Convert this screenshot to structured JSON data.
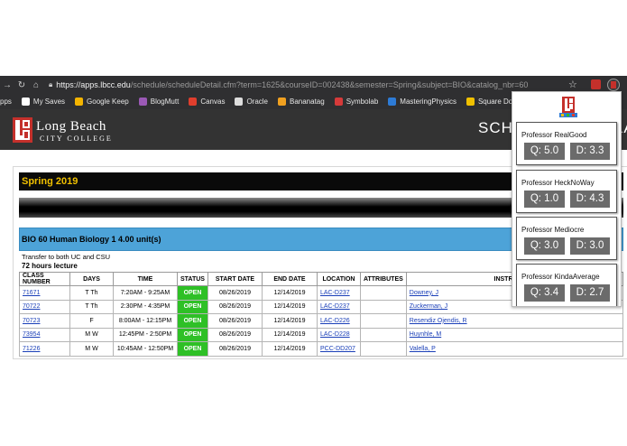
{
  "browser": {
    "url_host": "https://apps.lbcc.edu",
    "url_path": "/schedule/scheduleDetail.cfm?term=1625&courseID=002438&semester=Spring&subject=BIO&catalog_nbr=60",
    "bookmarks": [
      {
        "label": "pps",
        "icon": "apps-icon",
        "color": "#4a80f0"
      },
      {
        "label": "My Saves",
        "icon": "google-icon",
        "color": "#ffffff"
      },
      {
        "label": "Google Keep",
        "icon": "keep-icon",
        "color": "#f4b400"
      },
      {
        "label": "BlogMutt",
        "icon": "blogmutt-icon",
        "color": "#9b59b6"
      },
      {
        "label": "Canvas",
        "icon": "canvas-icon",
        "color": "#e03e2d"
      },
      {
        "label": "Oracle",
        "icon": "page-icon",
        "color": "#dddddd"
      },
      {
        "label": "Bananatag",
        "icon": "bananatag-icon",
        "color": "#f0a020"
      },
      {
        "label": "Symbolab",
        "icon": "symbolab-icon",
        "color": "#d63a3a"
      },
      {
        "label": "MasteringPhysics",
        "icon": "mastering-icon",
        "color": "#2d7bd6"
      },
      {
        "label": "Square Dots",
        "icon": "squaredots-icon",
        "color": "#f0c000"
      }
    ]
  },
  "site": {
    "logo_line1": "Long Beach",
    "logo_line2": "CITY COLLEGE",
    "page_title": "SCHEDULE OF CLASSES",
    "brand_red": "#c4302b"
  },
  "course": {
    "semester": "Spring 2019",
    "title": "BIO 60 Human Biology 1 4.00 unit(s)",
    "transfer": "Transfer to both UC and CSU",
    "hours": "72 hours lecture"
  },
  "table": {
    "headers": [
      "CLASS NUMBER",
      "DAYS",
      "TIME",
      "STATUS",
      "START DATE",
      "END DATE",
      "LOCATION",
      "ATTRIBUTES",
      "INSTRUCTOR"
    ],
    "rows": [
      {
        "class_number": "71671",
        "days": "T Th",
        "time": "7:20AM - 9:25AM",
        "status": "OPEN",
        "start": "08/26/2019",
        "end": "12/14/2019",
        "location": "LAC-D237",
        "attributes": "",
        "instructor": "Downey, J"
      },
      {
        "class_number": "70722",
        "days": "T Th",
        "time": "2:30PM - 4:35PM",
        "status": "OPEN",
        "start": "08/26/2019",
        "end": "12/14/2019",
        "location": "LAC-D237",
        "attributes": "",
        "instructor": "Zuckerman, J"
      },
      {
        "class_number": "70723",
        "days": "F",
        "time": "8:00AM - 12:15PM",
        "status": "OPEN",
        "start": "08/26/2019",
        "end": "12/14/2019",
        "location": "LAC-D226",
        "attributes": "",
        "instructor": "Resendiz Ojendis, R"
      },
      {
        "class_number": "73954",
        "days": "M W",
        "time": "12:45PM - 2:50PM",
        "status": "OPEN",
        "start": "08/26/2019",
        "end": "12/14/2019",
        "location": "LAC-D228",
        "attributes": "",
        "instructor": "Huynhle, M"
      },
      {
        "class_number": "71226",
        "days": "M W",
        "time": "10:45AM - 12:50PM",
        "status": "OPEN",
        "start": "08/26/2019",
        "end": "12/14/2019",
        "location": "PCC-DD207",
        "attributes": "",
        "instructor": "Valella, P"
      }
    ],
    "open_color": "#2ec026"
  },
  "popup": {
    "professors": [
      {
        "name": "Professor RealGood",
        "quality": "Q: 5.0",
        "difficulty": "D: 3.3"
      },
      {
        "name": "Professor HeckNoWay",
        "quality": "Q: 1.0",
        "difficulty": "D: 4.3"
      },
      {
        "name": "Professor Mediocre",
        "quality": "Q: 3.0",
        "difficulty": "D: 3.0"
      },
      {
        "name": "Professor KindaAverage",
        "quality": "Q: 3.4",
        "difficulty": "D: 2.7"
      }
    ]
  }
}
